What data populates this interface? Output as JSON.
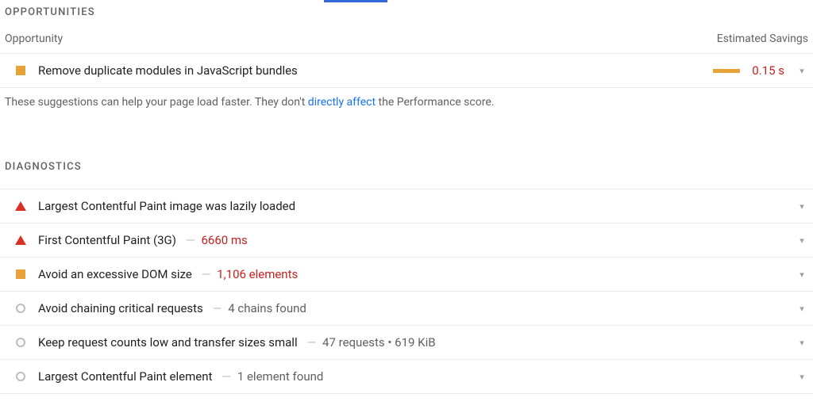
{
  "opportunities": {
    "heading": "OPPORTUNITIES",
    "col_opportunity": "Opportunity",
    "col_savings": "Estimated Savings",
    "items": [
      {
        "title": "Remove duplicate modules in JavaScript bundles",
        "savings": "0.15 s",
        "severity": "orange-square"
      }
    ],
    "footnote_prefix": "These suggestions can help your page load faster. They don't ",
    "footnote_link": "directly affect",
    "footnote_suffix": " the Performance score."
  },
  "diagnostics": {
    "heading": "DIAGNOSTICS",
    "items": [
      {
        "severity": "red-triangle",
        "title": "Largest Contentful Paint image was lazily loaded",
        "metric": ""
      },
      {
        "severity": "red-triangle",
        "title": "First Contentful Paint (3G)",
        "metric": "6660 ms",
        "metric_color": "red"
      },
      {
        "severity": "orange-square",
        "title": "Avoid an excessive DOM size",
        "metric": "1,106 elements",
        "metric_color": "red"
      },
      {
        "severity": "grey-circle",
        "title": "Avoid chaining critical requests",
        "metric": "4 chains found",
        "metric_color": "grey"
      },
      {
        "severity": "grey-circle",
        "title": "Keep request counts low and transfer sizes small",
        "metric": "47 requests • 619 KiB",
        "metric_color": "grey"
      },
      {
        "severity": "grey-circle",
        "title": "Largest Contentful Paint element",
        "metric": "1 element found",
        "metric_color": "grey"
      }
    ]
  }
}
